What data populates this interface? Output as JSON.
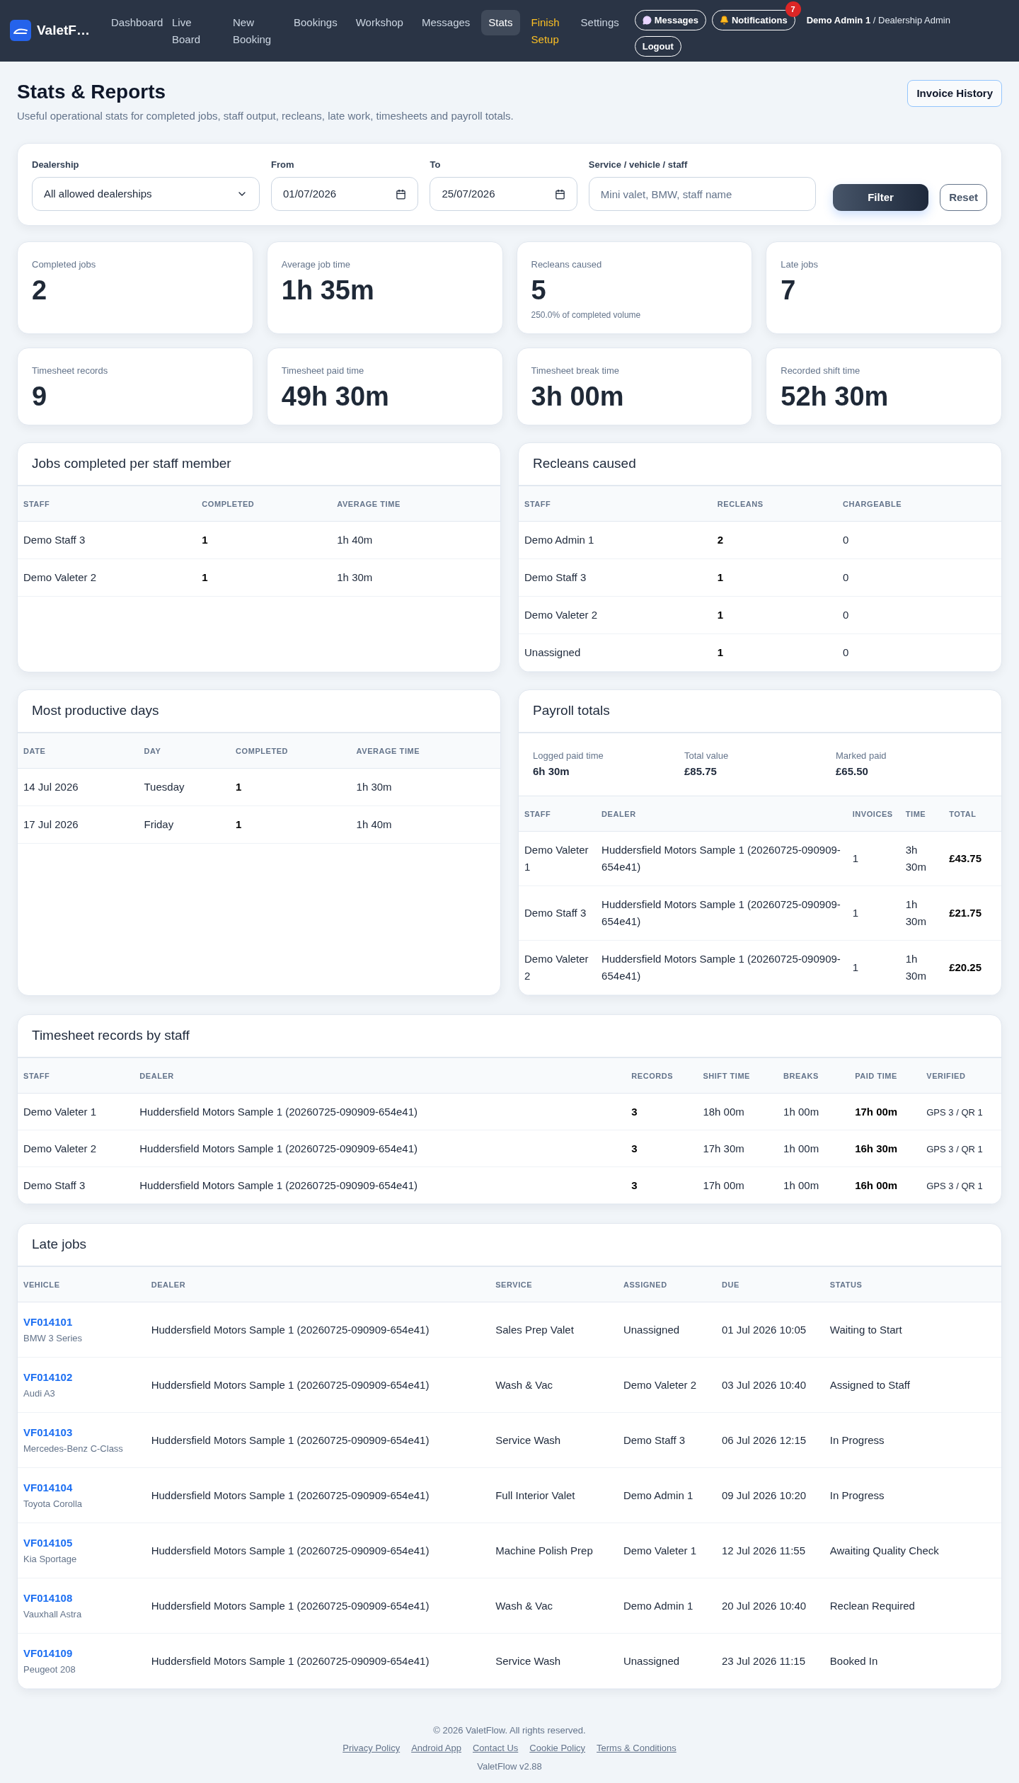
{
  "brand": {
    "name": "ValetF…"
  },
  "nav": [
    {
      "label": "Dashboard",
      "selected": false,
      "kind": "link"
    },
    {
      "label": "Live Board",
      "selected": false,
      "kind": "link"
    },
    {
      "label": "New Booking",
      "selected": false,
      "kind": "link"
    },
    {
      "label": "Bookings",
      "selected": false,
      "kind": "link"
    },
    {
      "label": "Workshop",
      "selected": false,
      "kind": "link"
    },
    {
      "label": "Messages",
      "selected": false,
      "kind": "link"
    },
    {
      "label": "Stats",
      "selected": true,
      "kind": "link"
    },
    {
      "label": "Finish Setup",
      "selected": false,
      "kind": "setup"
    },
    {
      "label": "Settings",
      "selected": false,
      "kind": "link"
    }
  ],
  "header_buttons": {
    "messages": "Messages",
    "notifications": "Notifications",
    "notification_count": "7",
    "logout": "Logout"
  },
  "user": {
    "name": "Demo Admin 1",
    "role": "/ Dealership Admin"
  },
  "page": {
    "title": "Stats & Reports",
    "subtitle": "Useful operational stats for completed jobs, staff output, recleans, late work, timesheets and payroll totals.",
    "action": "Invoice History"
  },
  "filters": {
    "dealership": {
      "label": "Dealership",
      "value": "All allowed dealerships"
    },
    "from": {
      "label": "From",
      "value": "01/07/2026"
    },
    "to": {
      "label": "To",
      "value": "25/07/2026"
    },
    "search": {
      "label": "Service / vehicle / staff",
      "placeholder": "Mini valet, BMW, staff name"
    },
    "filter_button": "Filter",
    "reset_button": "Reset"
  },
  "stats": [
    {
      "label": "Completed jobs",
      "value": "2"
    },
    {
      "label": "Average job time",
      "value": "1h 35m"
    },
    {
      "label": "Recleans caused",
      "value": "5",
      "note": "250.0% of completed volume"
    },
    {
      "label": "Late jobs",
      "value": "7"
    },
    {
      "label": "Timesheet records",
      "value": "9"
    },
    {
      "label": "Timesheet paid time",
      "value": "49h 30m"
    },
    {
      "label": "Timesheet break time",
      "value": "3h 00m"
    },
    {
      "label": "Recorded shift time",
      "value": "52h 30m"
    }
  ],
  "jobs_per_staff": {
    "title": "Jobs completed per staff member",
    "columns": [
      {
        "label": "STAFF",
        "bold": false
      },
      {
        "label": "COMPLETED",
        "bold": true
      },
      {
        "label": "AVERAGE TIME",
        "bold": false
      }
    ],
    "rows": [
      [
        "Demo Staff 3",
        "1",
        "1h 40m"
      ],
      [
        "Demo Valeter 2",
        "1",
        "1h 30m"
      ]
    ]
  },
  "recleans": {
    "title": "Recleans caused",
    "columns": [
      {
        "label": "STAFF",
        "bold": false
      },
      {
        "label": "RECLEANS",
        "bold": true
      },
      {
        "label": "CHARGEABLE",
        "bold": false
      }
    ],
    "rows": [
      [
        "Demo Admin 1",
        "2",
        "0"
      ],
      [
        "Demo Staff 3",
        "1",
        "0"
      ],
      [
        "Demo Valeter 2",
        "1",
        "0"
      ],
      [
        "Unassigned",
        "1",
        "0"
      ]
    ]
  },
  "productive_days": {
    "title": "Most productive days",
    "columns": [
      {
        "label": "DATE",
        "bold": false
      },
      {
        "label": "DAY",
        "bold": false
      },
      {
        "label": "COMPLETED",
        "bold": true
      },
      {
        "label": "AVERAGE TIME",
        "bold": false
      }
    ],
    "rows": [
      [
        "14 Jul 2026",
        "Tuesday",
        "1",
        "1h 30m"
      ],
      [
        "17 Jul 2026",
        "Friday",
        "1",
        "1h 40m"
      ]
    ]
  },
  "payroll": {
    "title": "Payroll totals",
    "summary": [
      {
        "label": "Logged paid time",
        "value": "6h 30m"
      },
      {
        "label": "Total value",
        "value": "£85.75"
      },
      {
        "label": "Marked paid",
        "value": "£65.50"
      }
    ],
    "columns": [
      {
        "label": "STAFF",
        "bold": false
      },
      {
        "label": "DEALER",
        "bold": false
      },
      {
        "label": "INVOICES",
        "bold": false
      },
      {
        "label": "TIME",
        "bold": false
      },
      {
        "label": "TOTAL",
        "bold": true
      }
    ],
    "rows": [
      [
        "Demo Valeter 1",
        "Huddersfield Motors Sample 1 (20260725-090909-654e41)",
        "1",
        "3h 30m",
        "£43.75"
      ],
      [
        "Demo Staff 3",
        "Huddersfield Motors Sample 1 (20260725-090909-654e41)",
        "1",
        "1h 30m",
        "£21.75"
      ],
      [
        "Demo Valeter 2",
        "Huddersfield Motors Sample 1 (20260725-090909-654e41)",
        "1",
        "1h 30m",
        "£20.25"
      ]
    ]
  },
  "timesheets": {
    "title": "Timesheet records by staff",
    "columns": [
      {
        "label": "STAFF",
        "bold": false
      },
      {
        "label": "DEALER",
        "bold": false
      },
      {
        "label": "RECORDS",
        "bold": true
      },
      {
        "label": "SHIFT TIME",
        "bold": false
      },
      {
        "label": "BREAKS",
        "bold": false
      },
      {
        "label": "PAID TIME",
        "bold": true
      },
      {
        "label": "VERIFIED",
        "bold": false
      }
    ],
    "rows": [
      [
        "Demo Valeter 1",
        "Huddersfield Motors Sample 1 (20260725-090909-654e41)",
        "3",
        "18h 00m",
        "1h 00m",
        "17h 00m",
        "GPS 3 / QR 1"
      ],
      [
        "Demo Valeter 2",
        "Huddersfield Motors Sample 1 (20260725-090909-654e41)",
        "3",
        "17h 30m",
        "1h 00m",
        "16h 30m",
        "GPS 3 / QR 1"
      ],
      [
        "Demo Staff 3",
        "Huddersfield Motors Sample 1 (20260725-090909-654e41)",
        "3",
        "17h 00m",
        "1h 00m",
        "16h 00m",
        "GPS 3 / QR 1"
      ]
    ]
  },
  "late_jobs": {
    "title": "Late jobs",
    "columns": [
      "VEHICLE",
      "DEALER",
      "SERVICE",
      "ASSIGNED",
      "DUE",
      "STATUS"
    ],
    "rows": [
      {
        "reg": "VF014101",
        "model": "BMW 3 Series",
        "dealer": "Huddersfield Motors Sample 1 (20260725-090909-654e41)",
        "service": "Sales Prep Valet",
        "assigned": "Unassigned",
        "due": "01 Jul 2026 10:05",
        "status": "Waiting to Start"
      },
      {
        "reg": "VF014102",
        "model": "Audi A3",
        "dealer": "Huddersfield Motors Sample 1 (20260725-090909-654e41)",
        "service": "Wash & Vac",
        "assigned": "Demo Valeter 2",
        "due": "03 Jul 2026 10:40",
        "status": "Assigned to Staff"
      },
      {
        "reg": "VF014103",
        "model": "Mercedes-Benz C-Class",
        "dealer": "Huddersfield Motors Sample 1 (20260725-090909-654e41)",
        "service": "Service Wash",
        "assigned": "Demo Staff 3",
        "due": "06 Jul 2026 12:15",
        "status": "In Progress"
      },
      {
        "reg": "VF014104",
        "model": "Toyota Corolla",
        "dealer": "Huddersfield Motors Sample 1 (20260725-090909-654e41)",
        "service": "Full Interior Valet",
        "assigned": "Demo Admin 1",
        "due": "09 Jul 2026 10:20",
        "status": "In Progress"
      },
      {
        "reg": "VF014105",
        "model": "Kia Sportage",
        "dealer": "Huddersfield Motors Sample 1 (20260725-090909-654e41)",
        "service": "Machine Polish Prep",
        "assigned": "Demo Valeter 1",
        "due": "12 Jul 2026 11:55",
        "status": "Awaiting Quality Check"
      },
      {
        "reg": "VF014108",
        "model": "Vauxhall Astra",
        "dealer": "Huddersfield Motors Sample 1 (20260725-090909-654e41)",
        "service": "Wash & Vac",
        "assigned": "Demo Admin 1",
        "due": "20 Jul 2026 10:40",
        "status": "Reclean Required"
      },
      {
        "reg": "VF014109",
        "model": "Peugeot 208",
        "dealer": "Huddersfield Motors Sample 1 (20260725-090909-654e41)",
        "service": "Service Wash",
        "assigned": "Unassigned",
        "due": "23 Jul 2026 11:15",
        "status": "Booked In"
      }
    ]
  },
  "footer": {
    "copyright": "© 2026 ValetFlow. All rights reserved.",
    "links": [
      "Privacy Policy",
      "Android App",
      "Contact Us",
      "Cookie Policy",
      "Terms & Conditions"
    ],
    "version": "ValetFlow v2.88"
  }
}
